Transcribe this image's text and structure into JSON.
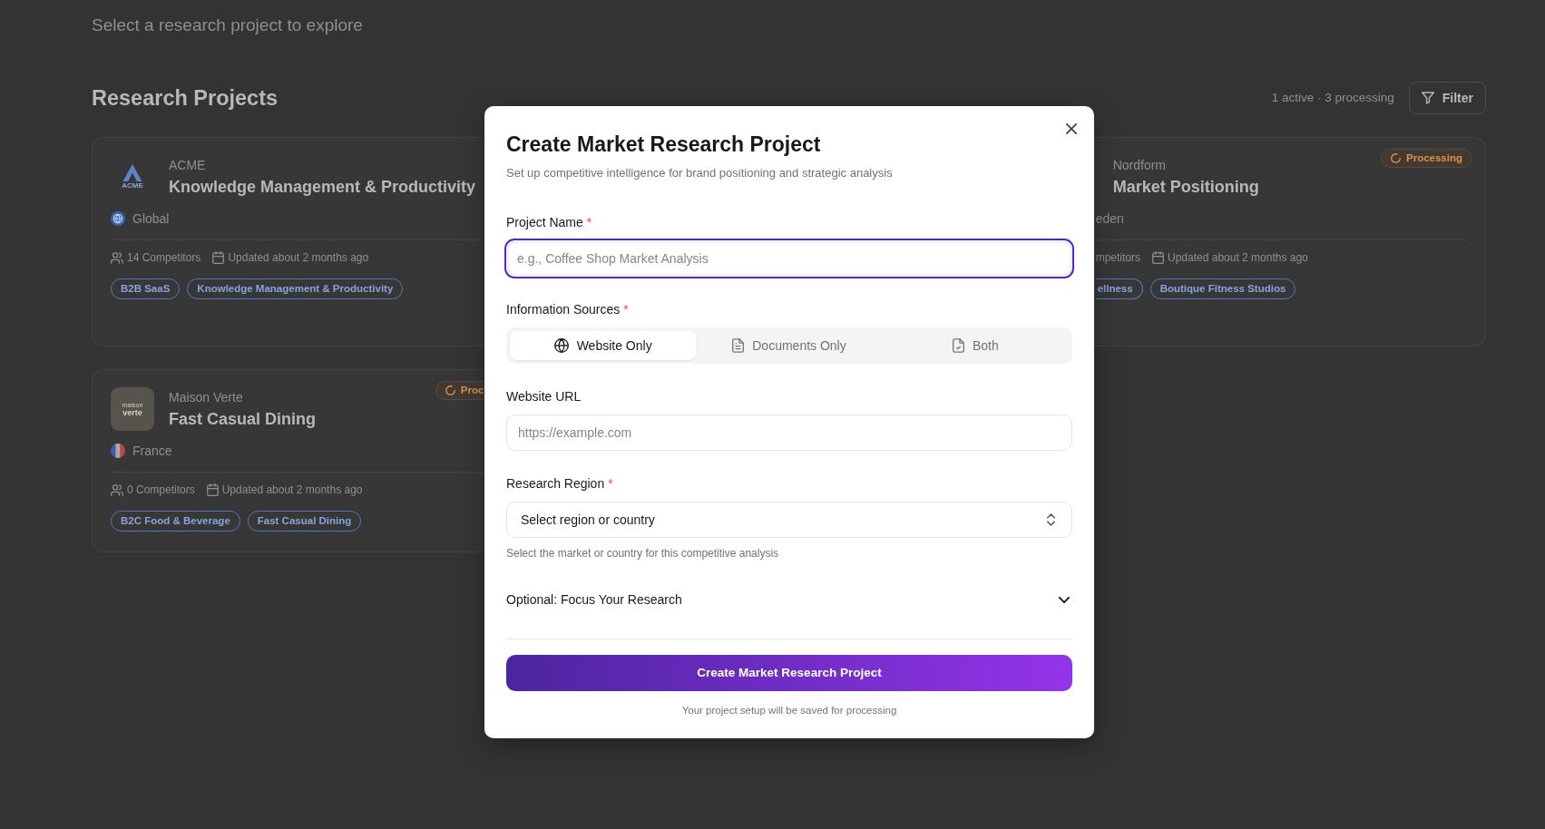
{
  "page": {
    "subtitle": "Select a research project to explore",
    "heading": "Research Projects",
    "summary": "1 active · 3 processing",
    "filter": "Filter"
  },
  "projects": [
    {
      "logo": {
        "kind": "mark",
        "lines": [
          "ACME"
        ]
      },
      "brand": "ACME",
      "title": "Knowledge Management & Productivity",
      "region": {
        "name": "Global",
        "kind": "globe"
      },
      "competitors": "14 Competitors",
      "updated": "Updated about 2 months ago",
      "tags": [
        "B2B SaaS",
        "Knowledge Management & Productivity"
      ]
    },
    {
      "covered": true,
      "status": "Processing",
      "brand": "Nordform",
      "title": "Market Positioning",
      "region": {
        "name": "eden"
      },
      "competitors": "mpetitors",
      "updated": "Updated about 2 months ago",
      "tags": [
        "ellness",
        "Boutique Fitness Studios"
      ]
    },
    {
      "covered": true,
      "status": "Proc",
      "logo": {
        "kind": "tile",
        "lines": [
          "maison",
          "verte"
        ]
      },
      "brand": "Maison Verte",
      "title": "Fast Casual Dining",
      "region": {
        "name": "France",
        "kind": "flag-fr"
      },
      "competitors": "0 Competitors",
      "updated": "Updated about 2 months ago",
      "tags": [
        "B2C Food & Beverage",
        "Fast Casual Dining"
      ]
    }
  ],
  "dialog": {
    "title": "Create Market Research Project",
    "subtitle": "Set up competitive intelligence for brand positioning and strategic analysis",
    "fields": [
      {
        "kind": "text",
        "label": "Project Name",
        "required_mark": "*",
        "placeholder": "e.g., Coffee Shop Market Analysis",
        "focused": true
      },
      {
        "kind": "segmented",
        "label": "Information Sources",
        "required_mark": "*",
        "options": [
          {
            "label": "Website Only",
            "selected": true
          },
          {
            "label": "Documents Only",
            "selected": false
          },
          {
            "label": "Both",
            "selected": false
          }
        ]
      },
      {
        "kind": "text",
        "label": "Website URL",
        "placeholder": "https://example.com",
        "focused": false
      },
      {
        "kind": "select",
        "label": "Research Region",
        "required_mark": "*",
        "placeholder": "Select region or country",
        "help": "Select the market or country for this competitive analysis"
      }
    ],
    "optional": {
      "label": "Optional: Focus Your Research",
      "expanded": false
    },
    "submit": "Create Market Research Project",
    "footnote": "Your project setup will be saved for processing"
  }
}
